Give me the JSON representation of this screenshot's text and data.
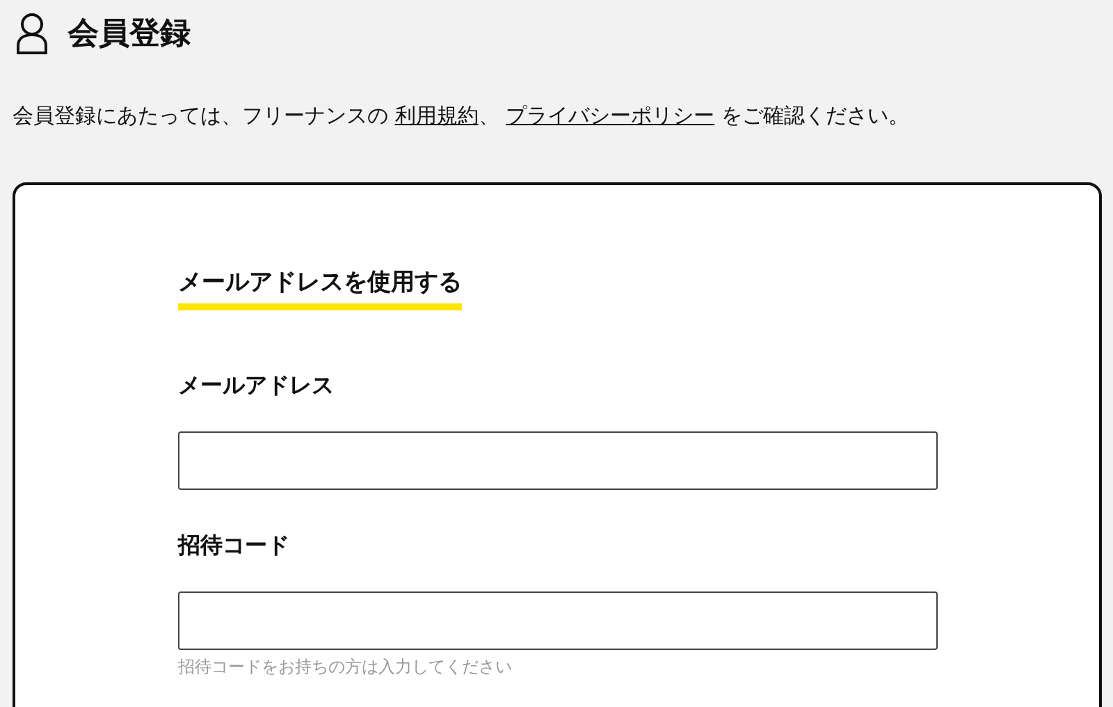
{
  "header": {
    "title": "会員登録"
  },
  "intro": [
    {
      "kind": "text",
      "text": "会員登録にあたっては、フリーナンスの "
    },
    {
      "kind": "link",
      "text": "利用規約"
    },
    {
      "kind": "text",
      "text": "、 "
    },
    {
      "kind": "link",
      "text": "プライバシーポリシー"
    },
    {
      "kind": "text",
      "text": " をご確認ください。"
    }
  ],
  "form": {
    "heading": "メールアドレスを使用する",
    "fields": [
      {
        "label": "メールアドレス"
      },
      {
        "label": "招待コード",
        "hint": "招待コードをお持ちの方は入力してください"
      }
    ]
  }
}
